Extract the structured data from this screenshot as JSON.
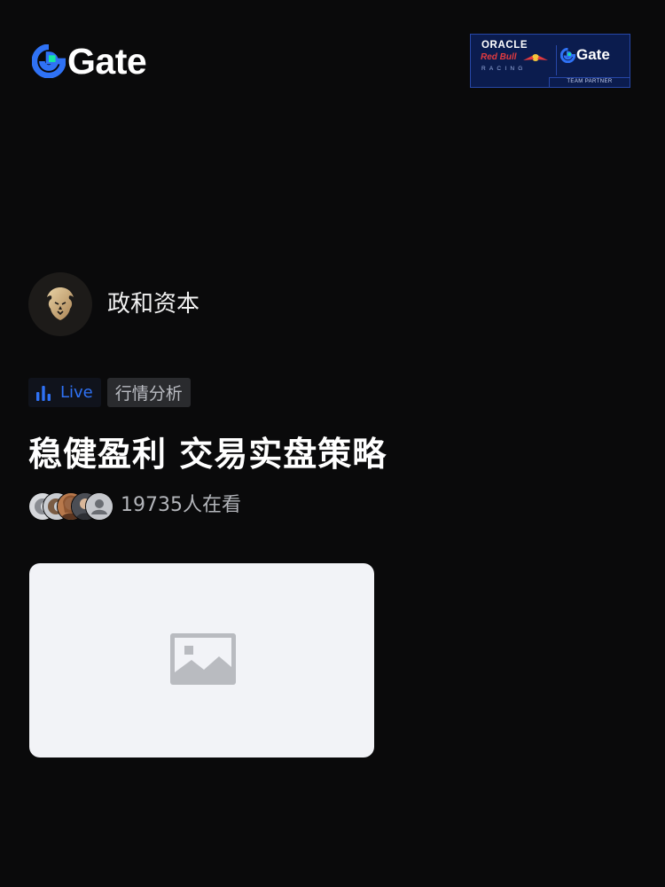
{
  "header": {
    "brand_name": "Gate",
    "partner_badge": {
      "oracle": "ORACLE",
      "redbull": "Red Bull",
      "racing": "RACING",
      "gate": "Gate",
      "footer": "TEAM PARTNER"
    }
  },
  "host": {
    "name": "政和资本",
    "avatar_icon": "lion-logo"
  },
  "tags": {
    "live_label": "Live",
    "category_label": "行情分析"
  },
  "stream": {
    "title": "稳健盈利 交易实盘策略",
    "viewer_count": "19735人在看"
  },
  "thumbnail": {
    "icon": "image-placeholder-icon"
  },
  "colors": {
    "background": "#0a0a0b",
    "accent_blue": "#2f72f5",
    "brand_green": "#17e6a1",
    "partner_navy": "#0b1c4e"
  }
}
